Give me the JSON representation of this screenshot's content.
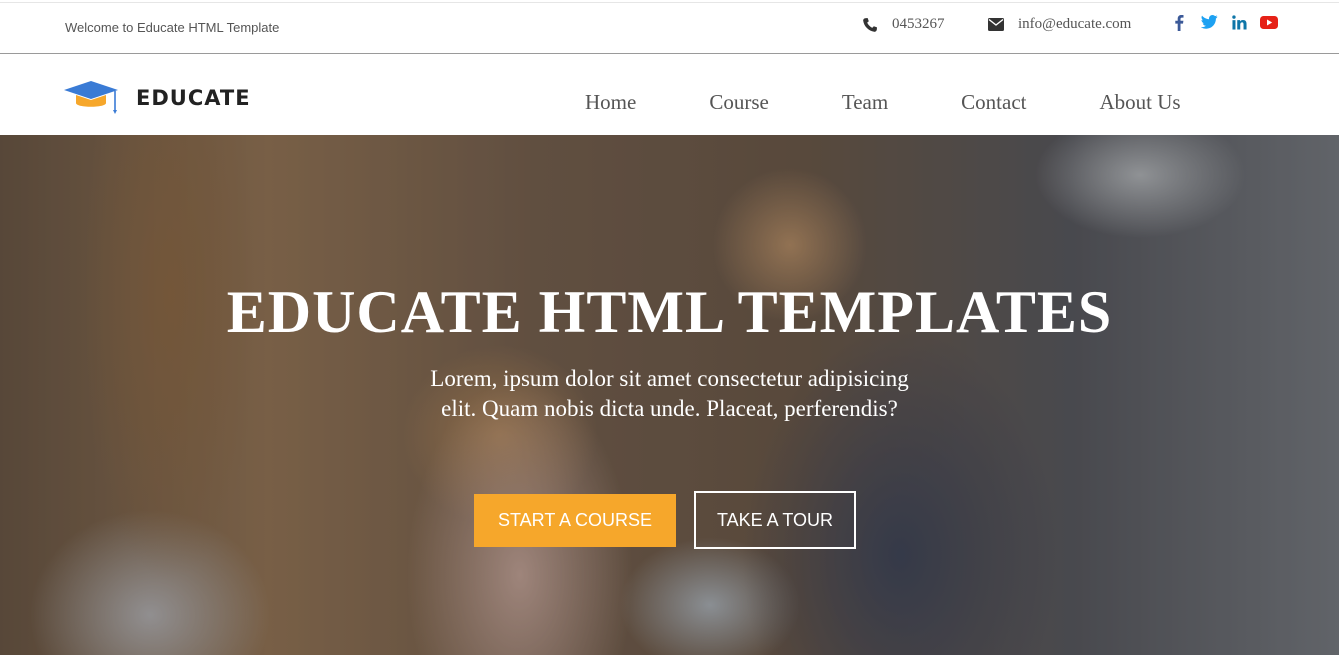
{
  "topbar": {
    "welcome": "Welcome to Educate HTML Template",
    "phone": "0453267",
    "email": "info@educate.com",
    "social": [
      {
        "icon": "facebook-icon",
        "color": "#3b5998"
      },
      {
        "icon": "twitter-icon",
        "color": "#1da1f2"
      },
      {
        "icon": "linkedin-icon",
        "color": "#0e76a8"
      },
      {
        "icon": "youtube-icon",
        "color": "#e62117"
      }
    ]
  },
  "navbar": {
    "brand": "EDUCATE",
    "links": [
      "Home",
      "Course",
      "Team",
      "Contact",
      "About Us"
    ]
  },
  "hero": {
    "title": "EDUCATE HTML TEMPLATES",
    "subtitle_line1": "Lorem, ipsum dolor sit amet consectetur adipisicing",
    "subtitle_line2": "elit. Quam nobis dicta unde. Placeat, perferendis?",
    "primary_button": "START A COURSE",
    "secondary_button": "TAKE A TOUR"
  },
  "colors": {
    "accent": "#f6a72b",
    "logo_blue": "#3a7bd5",
    "logo_orange": "#f6a72b"
  }
}
